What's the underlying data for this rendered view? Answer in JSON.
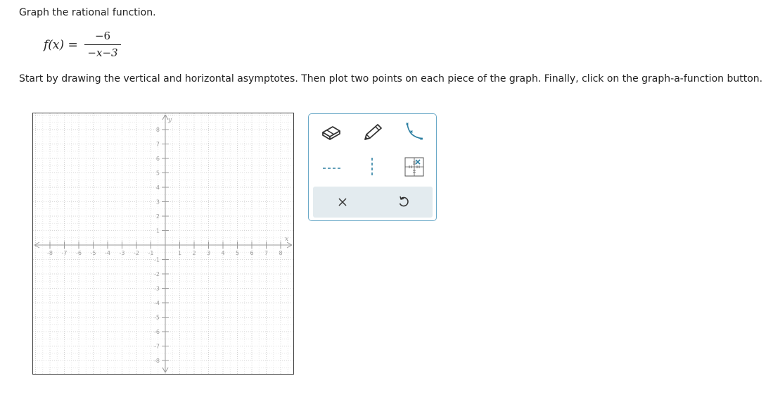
{
  "prompt": "Graph the rational function.",
  "formula": {
    "lhs": "f(x) =",
    "numerator": "−6",
    "denominator": "−x−3"
  },
  "instructions": "Start by drawing the vertical and horizontal asymptotes. Then plot two points on each piece of the graph. Finally, click on the graph-a-function button.",
  "graph": {
    "x_axis_label": "x",
    "y_axis_label": "y",
    "x_ticks": [
      "-8",
      "-7",
      "-6",
      "-5",
      "-4",
      "-3",
      "-2",
      "-1",
      "1",
      "2",
      "3",
      "4",
      "5",
      "6",
      "7",
      "8"
    ],
    "y_ticks": [
      "8",
      "7",
      "6",
      "5",
      "4",
      "3",
      "2",
      "1",
      "-1",
      "-2",
      "-3",
      "-4",
      "-5",
      "-6",
      "-7",
      "-8"
    ],
    "x_range": [
      -9,
      9
    ],
    "y_range": [
      -9,
      9
    ]
  },
  "toolbox": {
    "tools": [
      "eraser-icon",
      "pencil-icon",
      "rational-curve-icon",
      "horizontal-asymptote-icon",
      "vertical-asymptote-icon",
      "graph-function-icon"
    ],
    "actions": [
      "clear-icon",
      "undo-icon"
    ],
    "accent_color": "#2b7ea1",
    "border_color": "#6aa9c8",
    "actions_background": "#e3ebef"
  }
}
